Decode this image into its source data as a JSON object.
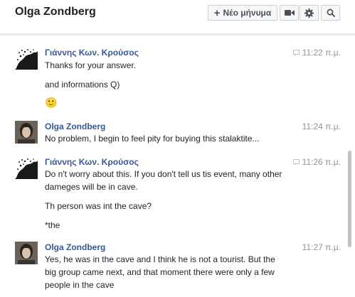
{
  "header": {
    "title": "Olga Zondberg",
    "new_message_label": "Νέο μήνυμα"
  },
  "messages": [
    {
      "sender": "Γιάννης Κων. Κρούσος",
      "time": "11:22 π.μ.",
      "lines": [
        "Thanks for your answer.",
        "and  informations Q)",
        "🙂"
      ]
    },
    {
      "sender": "Olga Zondberg",
      "time": "11:24 π.μ.",
      "lines": [
        "No problem, I begin to feel pity for buying this stalaktite..."
      ]
    },
    {
      "sender": "Γιάννης Κων. Κρούσος",
      "time": "11:26 π.μ.",
      "lines": [
        "Do n't worry about this. If you don't tell us tis event, many other",
        "dameges will be in cave.",
        "Th person was int the cave?",
        "*the"
      ]
    },
    {
      "sender": "Olga Zondberg",
      "time": "11:27 π.μ.",
      "lines": [
        "Yes, he was in the cave and I think he is not a tourist. But the",
        "big group came next, and that moment there were only a few",
        "people in the cave"
      ]
    }
  ],
  "icons": {
    "new_message": "plus-icon",
    "video": "video-camera-icon",
    "settings": "gear-icon",
    "search": "search-icon",
    "forwarded": "forward-icon"
  },
  "colors": {
    "sender_name": "#365899",
    "timestamp": "#90949c",
    "text": "#1d2129"
  }
}
